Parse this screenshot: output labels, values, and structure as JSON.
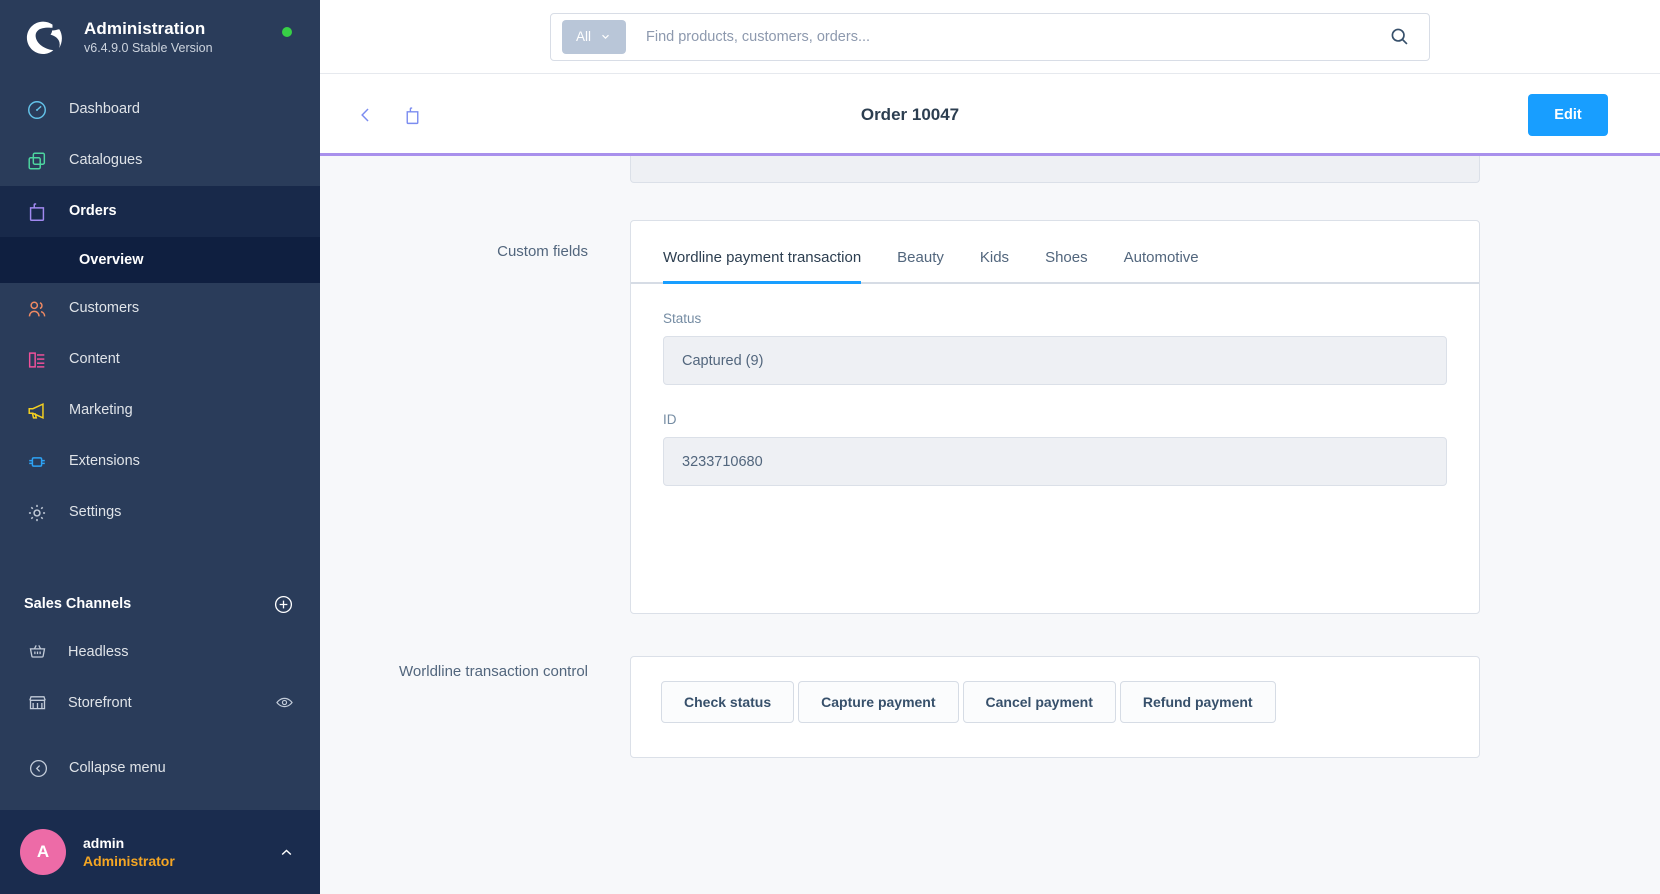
{
  "sidebar": {
    "app_title": "Administration",
    "version": "v6.4.9.0 Stable Version",
    "status_dot_color": "#37d046",
    "logo_icon": "shopware-logo-icon",
    "nav": [
      {
        "label": "Dashboard",
        "icon": "gauge-icon",
        "color": "#63c2e8",
        "active": false
      },
      {
        "label": "Catalogues",
        "icon": "copy-icon",
        "color": "#4dd6a0",
        "active": false
      },
      {
        "label": "Orders",
        "icon": "bag-icon",
        "color": "#a189f0",
        "active": true
      },
      {
        "label": "Customers",
        "icon": "users-icon",
        "color": "#f08a63",
        "active": false
      },
      {
        "label": "Content",
        "icon": "content-icon",
        "color": "#f0509a",
        "active": false
      },
      {
        "label": "Marketing",
        "icon": "megaphone-icon",
        "color": "#f5d020",
        "active": false
      },
      {
        "label": "Extensions",
        "icon": "plugin-icon",
        "color": "#2da3f5",
        "active": false
      },
      {
        "label": "Settings",
        "icon": "gear-icon",
        "color": "#c3ccd9",
        "active": false
      }
    ],
    "sub_item": {
      "label": "Overview"
    },
    "sales_channels": {
      "title": "Sales Channels",
      "add_icon": "plus-circle-icon",
      "items": [
        {
          "label": "Headless",
          "icon": "basket-icon",
          "trailing_icon": ""
        },
        {
          "label": "Storefront",
          "icon": "store-icon",
          "trailing_icon": "eye-icon"
        }
      ]
    },
    "collapse": {
      "label": "Collapse menu",
      "icon": "chevron-left-circle-icon"
    },
    "user": {
      "initial": "A",
      "name": "admin",
      "role": "Administrator",
      "avatar_color": "#ed6ba7",
      "role_color": "#f5a623",
      "chevron_icon": "chevron-up-icon"
    }
  },
  "topbar": {
    "scope_label": "All",
    "scope_chevron_icon": "chevron-down-icon",
    "search_placeholder": "Find products, customers, orders...",
    "search_value": "",
    "search_icon": "search-icon"
  },
  "smartbar": {
    "back_icon": "chevron-left-icon",
    "order_icon": "bag-icon",
    "title": "Order 10047",
    "edit_label": "Edit",
    "edit_color": "#189eff",
    "loader_color": "#a990ec"
  },
  "content": {
    "custom_fields": {
      "label": "Custom fields",
      "tabs": [
        {
          "label": "Wordline payment transaction",
          "active": true
        },
        {
          "label": "Beauty",
          "active": false
        },
        {
          "label": "Kids",
          "active": false
        },
        {
          "label": "Shoes",
          "active": false
        },
        {
          "label": "Automotive",
          "active": false
        }
      ],
      "fields": [
        {
          "label": "Status",
          "value": "Captured (9)"
        },
        {
          "label": "ID",
          "value": "3233710680"
        }
      ]
    },
    "transaction_control": {
      "label": "Worldline transaction control",
      "buttons": [
        {
          "label": "Check status"
        },
        {
          "label": "Capture payment"
        },
        {
          "label": "Cancel payment"
        },
        {
          "label": "Refund payment"
        }
      ]
    }
  }
}
